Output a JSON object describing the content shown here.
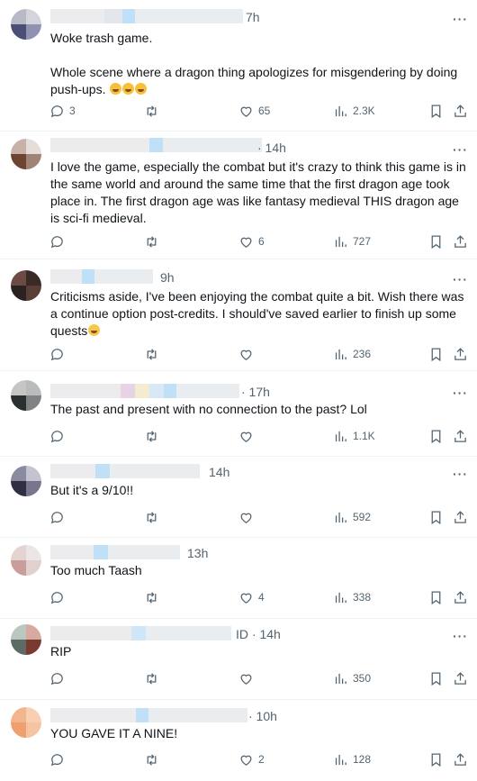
{
  "posts": [
    {
      "time": "7h",
      "text": "Woke trash game.\n\nWhole scene where a dragon thing apologizes for misgendering by doing push-ups. ",
      "emoji": "🤣🤣🤣",
      "replies": "3",
      "reposts": "",
      "likes": "65",
      "views": "2.3K"
    },
    {
      "time": "· 14h",
      "text": "I love the game, especially the combat but it's crazy to think this game is in the same world and around the same time that the first dragon age took place in. The first dragon age was like fantasy medieval THIS dragon age is sci-fi medieval.",
      "emoji": "",
      "replies": "",
      "reposts": "",
      "likes": "6",
      "views": "727"
    },
    {
      "time": "9h",
      "text": "Criticisms aside, I've been enjoying the combat quite a bit. Wish there was a continue option post-credits. I should've saved earlier to finish up some quests",
      "emoji": "😢",
      "replies": "",
      "reposts": "",
      "likes": "",
      "views": "236"
    },
    {
      "time": "· 17h",
      "text": "The past and present with no connection to the past? Lol",
      "emoji": "",
      "replies": "",
      "reposts": "",
      "likes": "",
      "views": "1.1K"
    },
    {
      "time": "14h",
      "text": "But it's a 9/10!!",
      "emoji": "",
      "replies": "",
      "reposts": "",
      "likes": "",
      "views": "592"
    },
    {
      "time": "13h",
      "text": "Too much Taash",
      "emoji": "",
      "replies": "",
      "reposts": "",
      "likes": "4",
      "views": "338"
    },
    {
      "time": "ID · 14h",
      "text": "RIP",
      "emoji": "",
      "replies": "",
      "reposts": "",
      "likes": "",
      "views": "350"
    },
    {
      "time": "· 10h",
      "text": "YOU GAVE IT A NINE!",
      "emoji": "",
      "replies": "",
      "reposts": "",
      "likes": "2",
      "views": "128"
    }
  ],
  "more_label": "···",
  "colors": {
    "text": "#0f1419",
    "secondary": "#536471",
    "divider": "#eff3f4"
  },
  "icons": {
    "reply": "reply-icon",
    "repost": "repost-icon",
    "like": "like-icon",
    "views": "views-icon",
    "bookmark": "bookmark-icon",
    "share": "share-icon",
    "more": "more-icon"
  }
}
